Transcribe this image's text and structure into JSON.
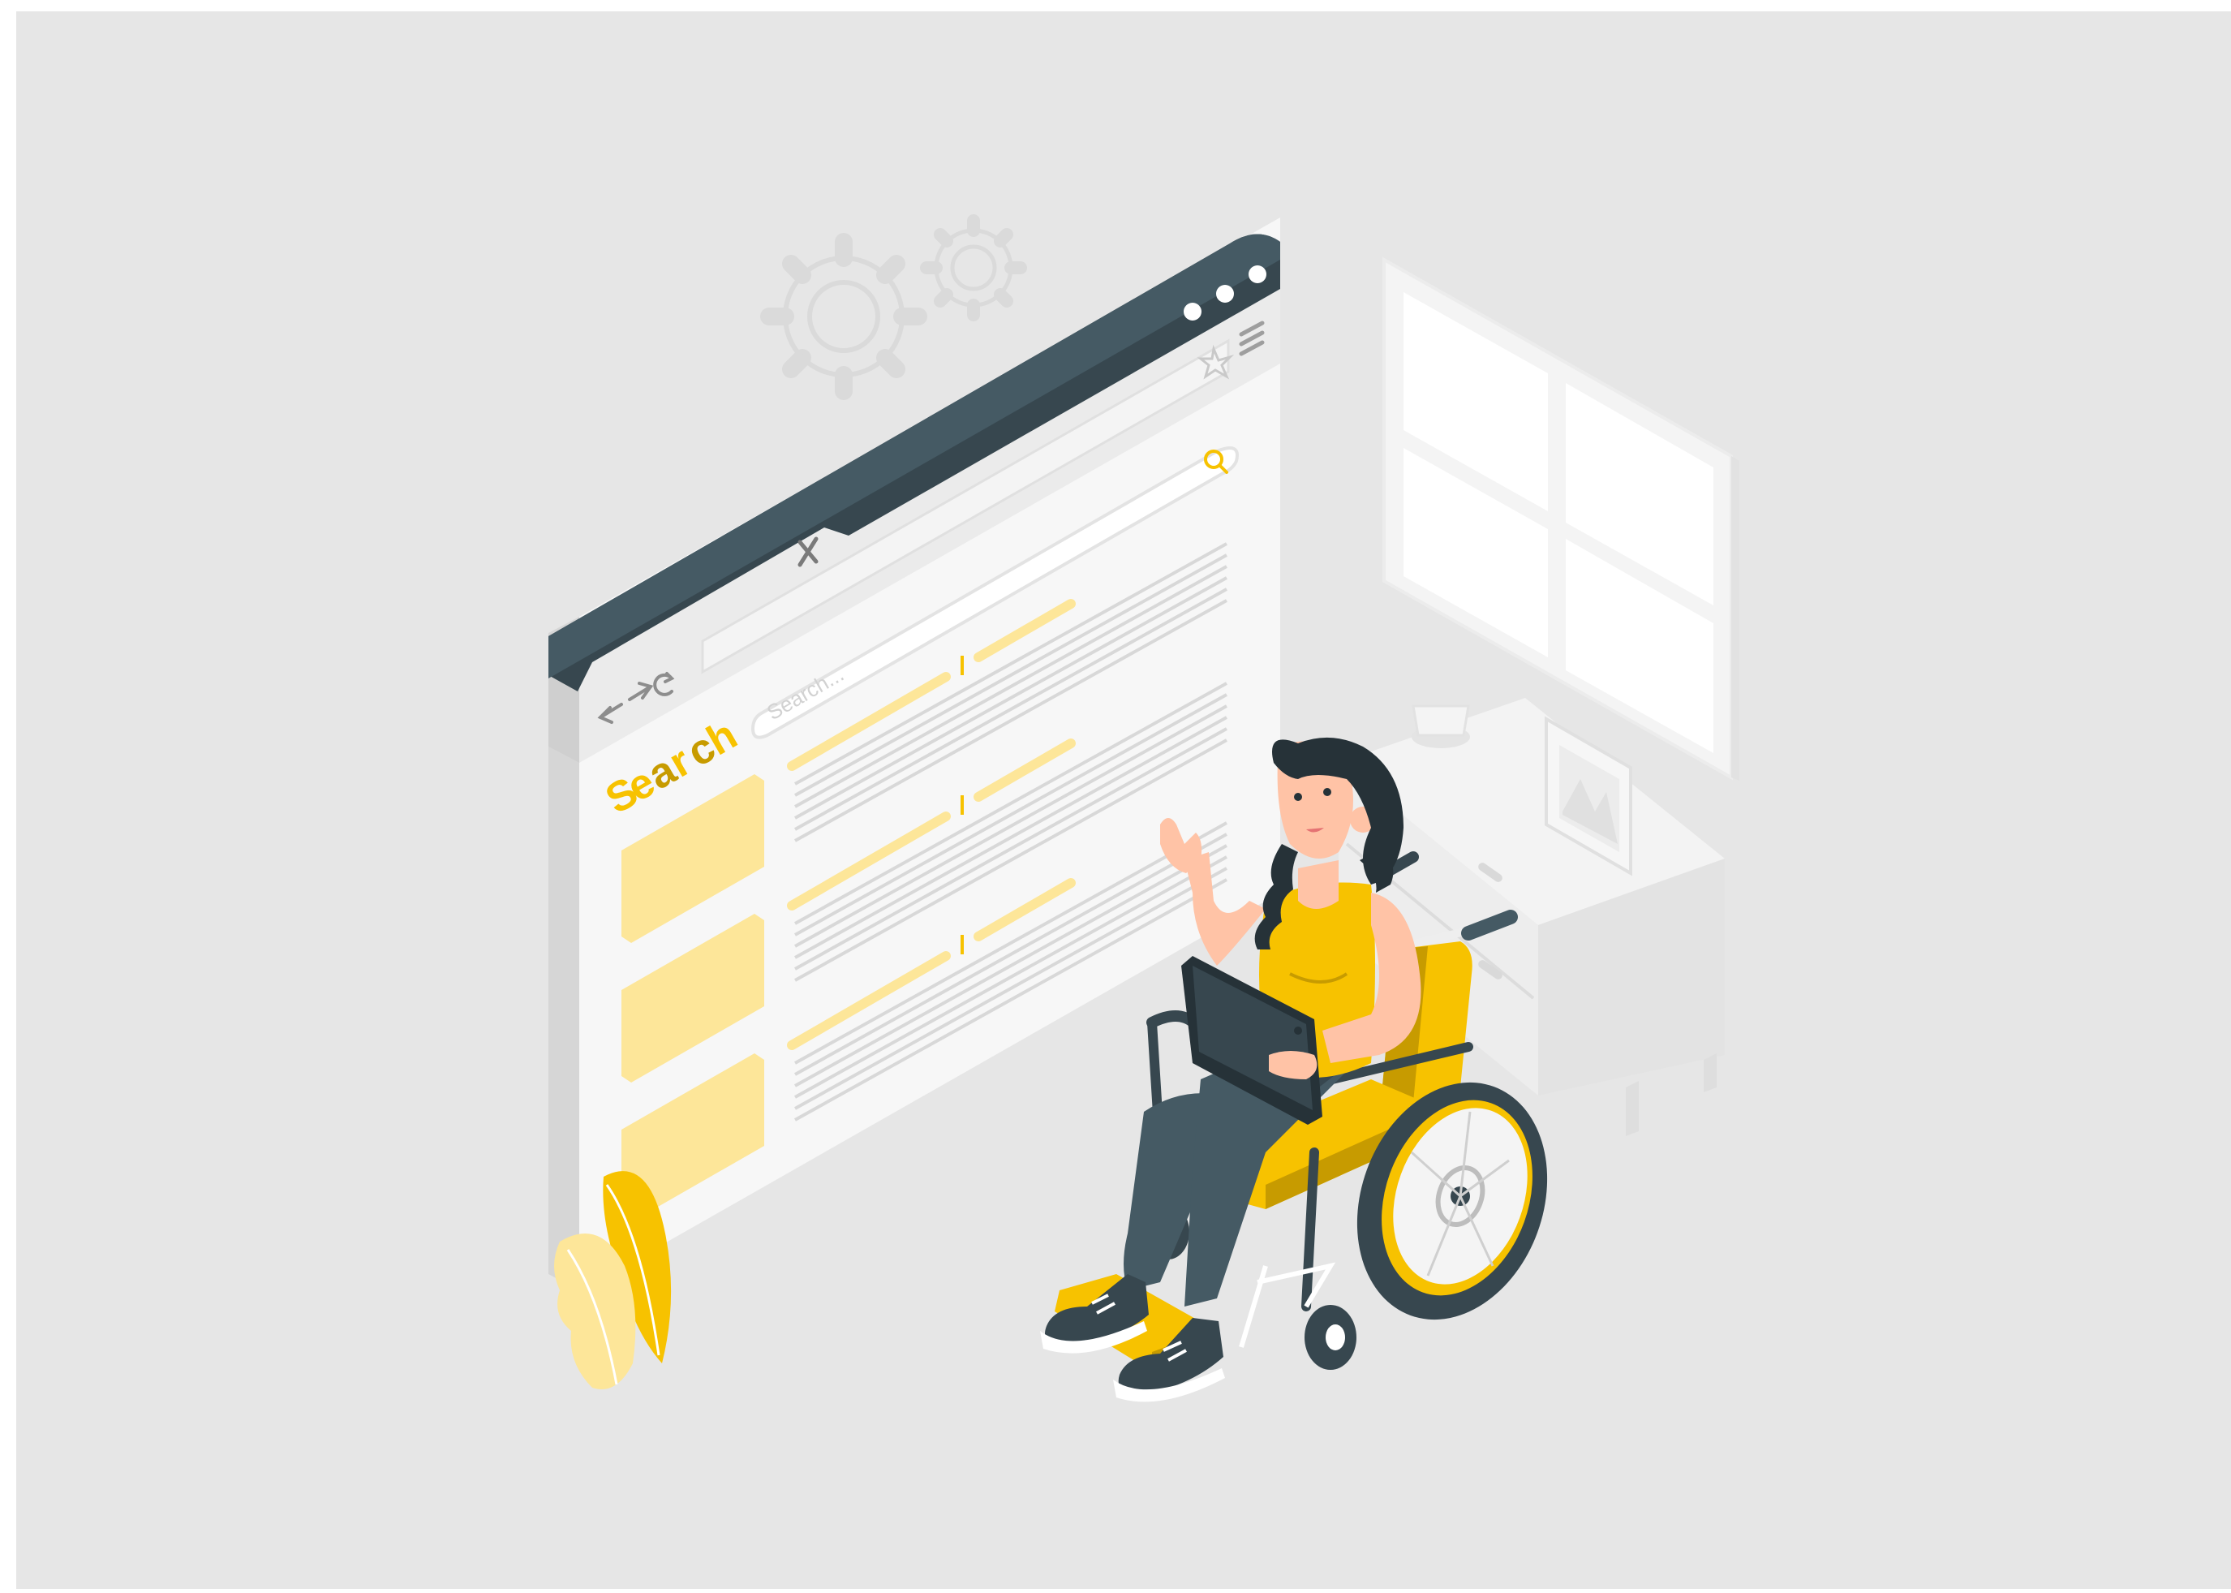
{
  "browser": {
    "search_placeholder": "Search...",
    "logo_letters": [
      "S",
      "e",
      "a",
      "r",
      "c",
      "h"
    ]
  },
  "icons": {
    "back": "arrow-left-icon",
    "forward": "arrow-right-icon",
    "reload": "reload-icon",
    "close_tab": "close-icon",
    "bookmark": "star-icon",
    "menu": "hamburger-menu-icon",
    "search": "magnifier-icon",
    "settings": "gear-icon",
    "window_controls": "window-dots-icon"
  },
  "colors": {
    "background": "#e6e6e6",
    "frame_dark": "#37474f",
    "accent_yellow": "#f7c200",
    "accent_light_yellow": "#fde699",
    "skin": "#ffc3a6",
    "pants": "#455a64",
    "page_white": "#f7f7f7"
  }
}
